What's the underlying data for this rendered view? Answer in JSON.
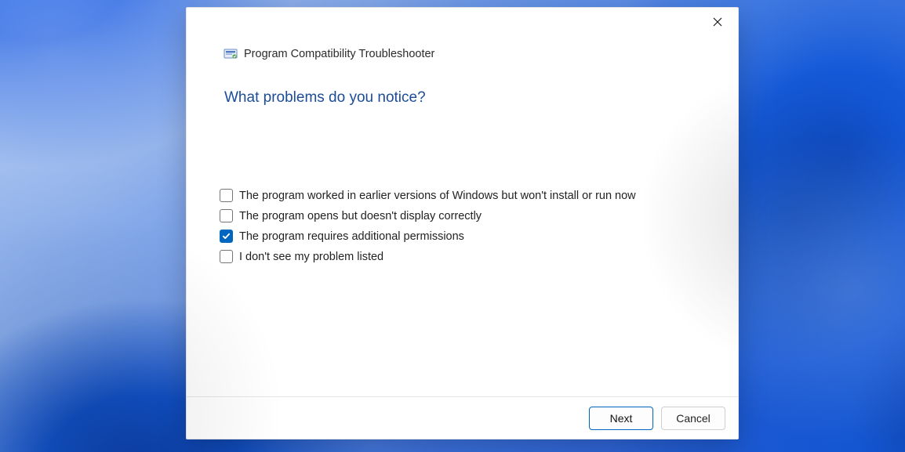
{
  "window": {
    "title": "Program Compatibility Troubleshooter"
  },
  "question": "What problems do you notice?",
  "options": [
    {
      "label": "The program worked in earlier versions of Windows but won't install or run now",
      "checked": false
    },
    {
      "label": "The program opens but doesn't display correctly",
      "checked": false
    },
    {
      "label": "The program requires additional permissions",
      "checked": true
    },
    {
      "label": "I don't see my problem listed",
      "checked": false
    }
  ],
  "buttons": {
    "next": "Next",
    "cancel": "Cancel"
  },
  "colors": {
    "accent": "#0067c0",
    "heading": "#1c4c97"
  }
}
